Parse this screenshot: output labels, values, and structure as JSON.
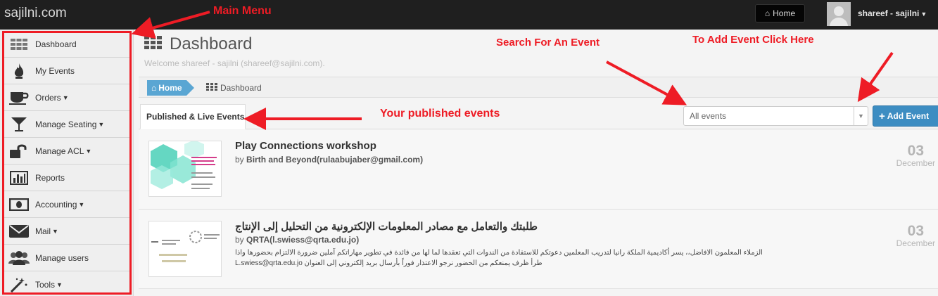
{
  "topbar": {
    "brand": "sajilni.com",
    "home_label": "Home",
    "user_label": "shareef - sajilni"
  },
  "sidebar": {
    "items": [
      {
        "label": "Dashboard",
        "icon": "grid-icon",
        "caret": false
      },
      {
        "label": "My Events",
        "icon": "flame-icon",
        "caret": false
      },
      {
        "label": "Orders",
        "icon": "coffee-cup-icon",
        "caret": true
      },
      {
        "label": "Manage Seating",
        "icon": "cocktail-glass-icon",
        "caret": true
      },
      {
        "label": "Manage ACL",
        "icon": "unlock-icon",
        "caret": true
      },
      {
        "label": "Reports",
        "icon": "bar-chart-icon",
        "caret": false
      },
      {
        "label": "Accounting",
        "icon": "money-bill-icon",
        "caret": true
      },
      {
        "label": "Mail",
        "icon": "envelope-icon",
        "caret": true
      },
      {
        "label": "Manage users",
        "icon": "users-icon",
        "caret": false
      },
      {
        "label": "Tools",
        "icon": "magic-wand-icon",
        "caret": true
      }
    ]
  },
  "main": {
    "title": "Dashboard",
    "welcome": "Welcome shareef - sajilni (shareef@sajilni.com).",
    "breadcrumb": {
      "home": "Home",
      "current": "Dashboard"
    },
    "tab_label": "Published & Live Events",
    "filter_value": "All events",
    "add_button": "Add Event"
  },
  "events": [
    {
      "title": "Play Connections workshop",
      "by_prefix": "by",
      "organizer": "Birth and Beyond(rulaabujaber@gmail.com)",
      "description": "",
      "day": "03",
      "month": "December"
    },
    {
      "title": "طلبتك والتعامل مع مصادر المعلومات الإلكترونية من التحليل إلى الإنتاج",
      "by_prefix": "by",
      "organizer": "QRTA(l.swiess@qrta.edu.jo)",
      "description": "الزملاء المعلمون الافاضل،، يسر أكاديمية الملكة رانيا لتدريب المعلمين دعوتكم للاستفادة من الندوات التي تعقدها لما لها من فائدة في تطوير مهاراتكم آملين ضرورة الالتزام بحضورها واذا طرأ ظرف يمنعكم من الحضور نرجو الاعتذار فوراً بأرسال بريد إلكتروني إلى العنوان L.swiess@qrta.edu.jo",
      "day": "03",
      "month": "December"
    }
  ],
  "annotations": {
    "main_menu": "Main Menu",
    "search": "Search For An Event",
    "add_event": "To Add Event Click Here",
    "published": "Your published events"
  },
  "colors": {
    "annotation": "#ee1c25",
    "accent": "#3d8dc2",
    "topbar": "#1f1f1f"
  }
}
